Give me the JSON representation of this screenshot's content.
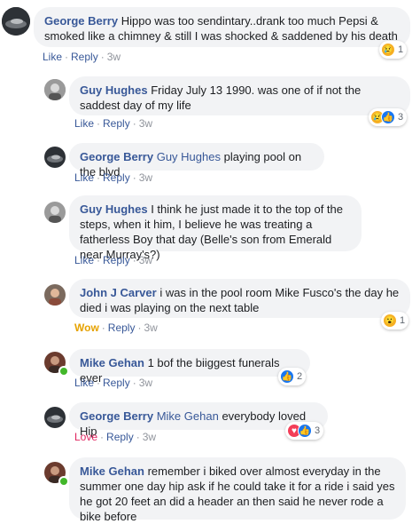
{
  "actions": {
    "like": "Like",
    "reply": "Reply",
    "wow": "Wow",
    "love": "Love",
    "sep": "·"
  },
  "comments": [
    {
      "name": "George Berry",
      "tag": "",
      "text": "Hippo was too sendintary..drank too much Pepsi & smoked like a chimney & still I was shocked & saddened by his death",
      "time": "3w",
      "reactions": [
        "sad"
      ],
      "reaction_count": "1"
    },
    {
      "name": "Guy Hughes",
      "tag": "",
      "text": "Friday July 13 1990. was one of if not the saddest day of my life",
      "time": "3w",
      "reactions": [
        "sad",
        "like"
      ],
      "reaction_count": "3"
    },
    {
      "name": "George Berry",
      "tag": "Guy Hughes",
      "text": "playing pool on the blvd",
      "time": "3w"
    },
    {
      "name": "Guy Hughes",
      "tag": "",
      "text": "I think he just made it to the top of the steps, when it him, I believe he was treating a fatherless Boy that day (Belle's son from Emerald near Murray's?)",
      "time": "3w"
    },
    {
      "name": "John J Carver",
      "tag": "",
      "text": "i was in the pool room Mike Fusco's the day he died i was playing on the next table",
      "time": "3w",
      "reactions": [
        "wow"
      ],
      "reaction_count": "1",
      "my_reaction": "Wow"
    },
    {
      "name": "Mike Gehan",
      "tag": "",
      "text": "1 bof the biiggest funerals ever",
      "time": "3w",
      "reactions": [
        "like"
      ],
      "reaction_count": "2"
    },
    {
      "name": "George Berry",
      "tag": "Mike Gehan",
      "text": "everybody loved Hip",
      "time": "3w",
      "reactions": [
        "love",
        "like"
      ],
      "reaction_count": "3",
      "my_reaction": "Love"
    },
    {
      "name": "Mike Gehan",
      "tag": "",
      "text": "remember i biked over almost everyday in the summer one day hip ask if he could take it for a ride i said yes he got 20 feet an did a header an then said he never rode a bike before",
      "time": ""
    }
  ],
  "colors": {
    "link": "#385898",
    "bubble": "#f2f3f5",
    "meta": "#90949c",
    "wow": "#e6a200",
    "love": "#e0245e",
    "online": "#42b72a"
  },
  "icons": {
    "sad": "sad-reaction-icon",
    "like": "like-reaction-icon",
    "wow": "wow-reaction-icon",
    "love": "love-reaction-icon"
  }
}
